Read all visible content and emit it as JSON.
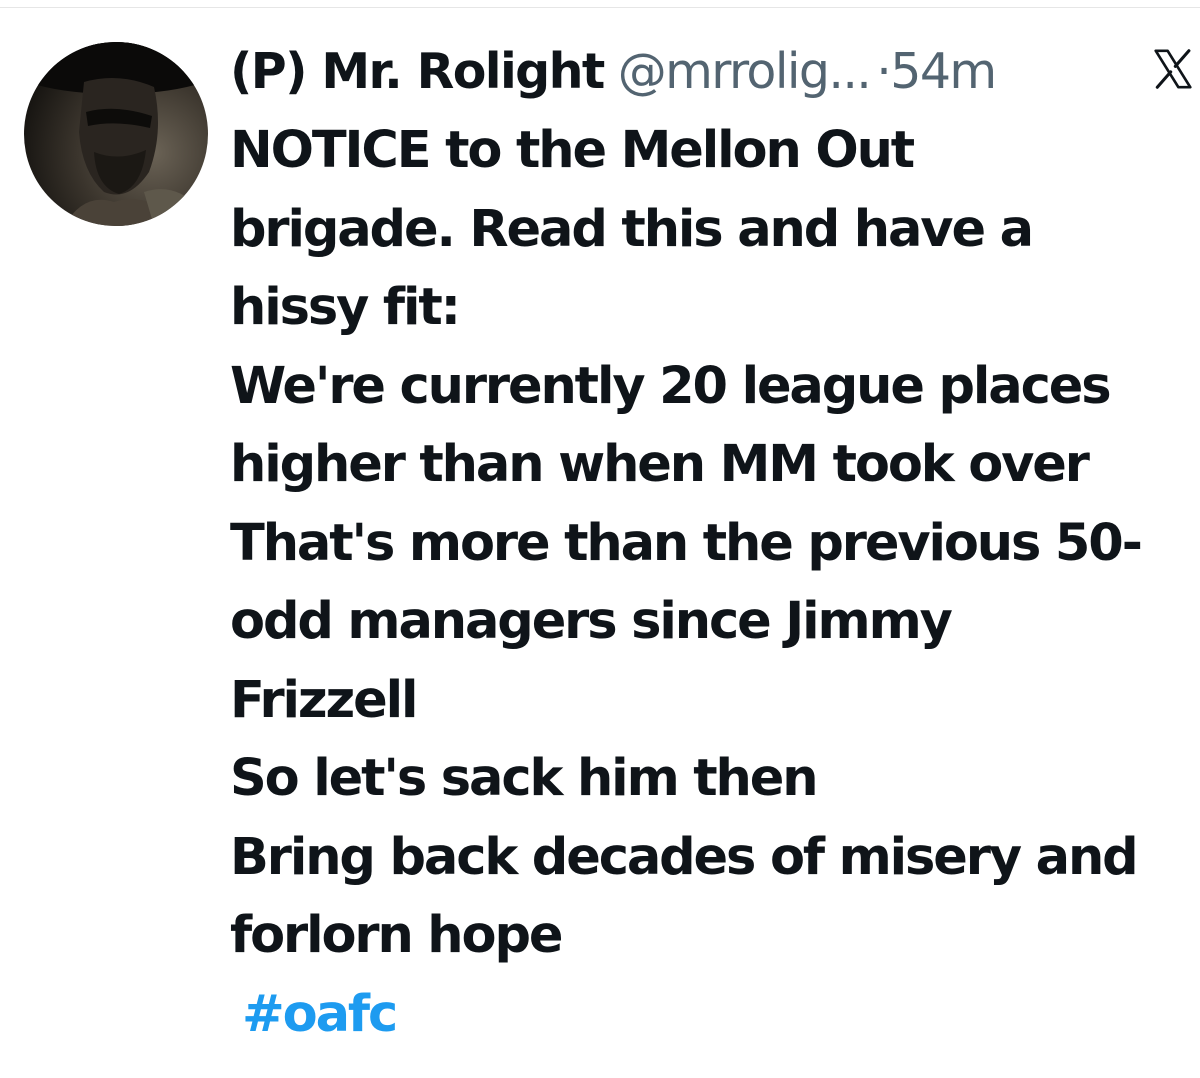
{
  "tweet": {
    "display_name": "(P) Mr. Rolight",
    "handle": "@mrrolig...",
    "separator": "·",
    "time": "54m",
    "body_lines": [
      "NOTICE to the Mellon Out",
      "brigade. Read this and have a",
      "hissy fit:",
      "We're currently 20 league places",
      "higher than when MM took over",
      "That's more than the previous 50-",
      "odd managers since Jimmy",
      "Frizzell",
      "So let's sack him then",
      "Bring back decades of misery and",
      "forlorn hope"
    ],
    "hashtag": "#oafc",
    "icons": {
      "avatar": "avatar-photo",
      "platform": "x-logo-icon"
    },
    "colors": {
      "text": "#0f1419",
      "secondary": "#536471",
      "link": "#1d9bf0"
    }
  }
}
